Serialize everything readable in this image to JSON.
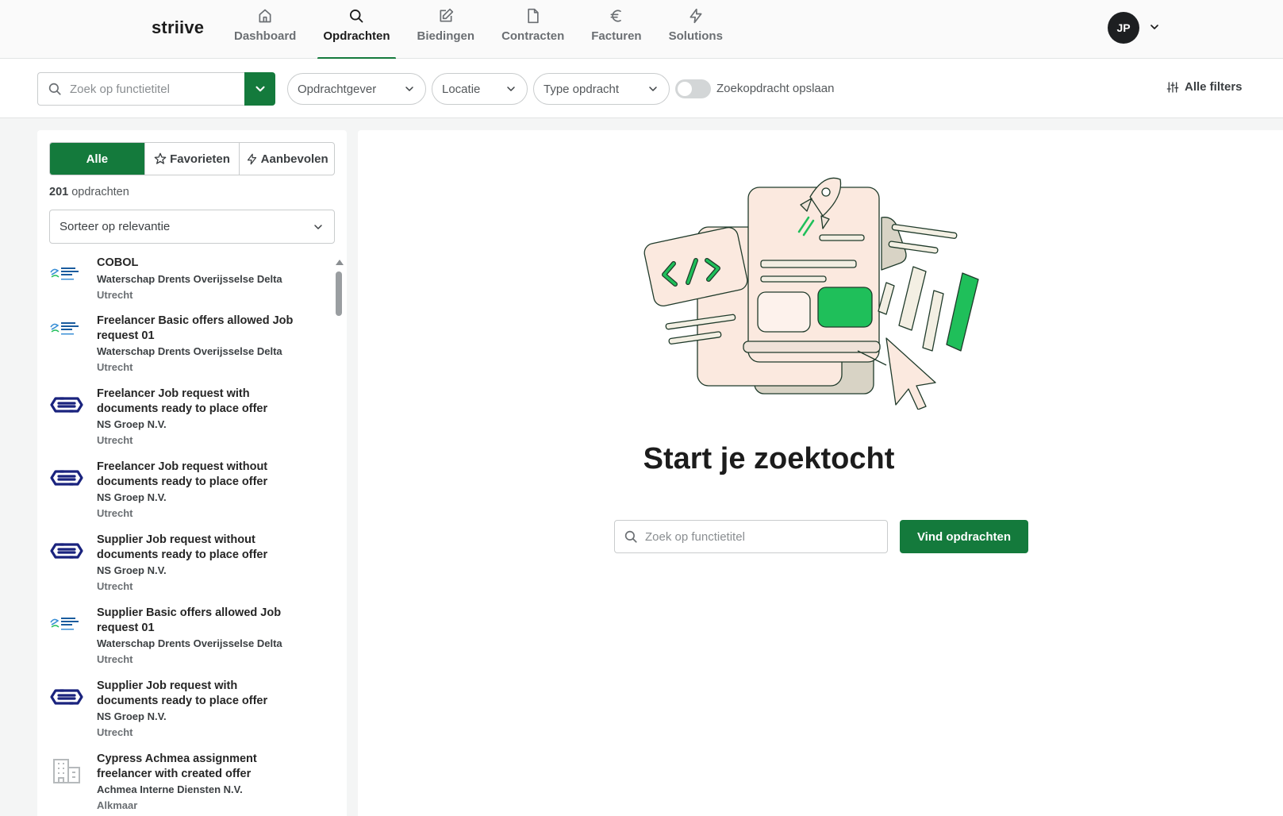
{
  "app": {
    "logo_text": "striive"
  },
  "nav": {
    "items": [
      {
        "label": "Dashboard",
        "icon": "home-icon",
        "active": false
      },
      {
        "label": "Opdrachten",
        "icon": "search-icon",
        "active": true
      },
      {
        "label": "Biedingen",
        "icon": "edit-icon",
        "active": false
      },
      {
        "label": "Contracten",
        "icon": "document-icon",
        "active": false
      },
      {
        "label": "Facturen",
        "icon": "euro-icon",
        "active": false
      },
      {
        "label": "Solutions",
        "icon": "bolt-icon",
        "active": false
      }
    ]
  },
  "user": {
    "initials": "JP"
  },
  "filters": {
    "search_placeholder": "Zoek op functietitel",
    "opdrachtgever": "Opdrachtgever",
    "locatie": "Locatie",
    "type": "Type opdracht",
    "save_search_label": "Zoekopdracht opslaan",
    "save_search_on": false,
    "all_filters": "Alle filters"
  },
  "list": {
    "tabs": {
      "all": "Alle",
      "favorites": "Favorieten",
      "recommended": "Aanbevolen"
    },
    "count_number": "201",
    "count_suffix": " opdrachten",
    "sort": "Sorteer op relevantie",
    "results": [
      {
        "title": "COBOL",
        "client": "Waterschap Drents Overijsselse Delta",
        "location": "Utrecht",
        "logo": "wdod-logo"
      },
      {
        "title": "Freelancer Basic offers allowed Job request 01",
        "client": "Waterschap Drents Overijsselse Delta",
        "location": "Utrecht",
        "logo": "wdod-logo"
      },
      {
        "title": "Freelancer Job request with documents ready to place offer",
        "client": "NS Groep N.V.",
        "location": "Utrecht",
        "logo": "ns-logo"
      },
      {
        "title": "Freelancer Job request without documents ready to place offer",
        "client": "NS Groep N.V.",
        "location": "Utrecht",
        "logo": "ns-logo"
      },
      {
        "title": "Supplier Job request without documents ready to place offer",
        "client": "NS Groep N.V.",
        "location": "Utrecht",
        "logo": "ns-logo"
      },
      {
        "title": "Supplier Basic offers allowed Job request 01",
        "client": "Waterschap Drents Overijsselse Delta",
        "location": "Utrecht",
        "logo": "wdod-logo"
      },
      {
        "title": "Supplier Job request with documents ready to place offer",
        "client": "NS Groep N.V.",
        "location": "Utrecht",
        "logo": "ns-logo"
      },
      {
        "title": "Cypress Achmea assignment freelancer with created offer",
        "client": "Achmea Interne Diensten N.V.",
        "location": "Alkmaar",
        "logo": "building-icon"
      }
    ]
  },
  "main": {
    "headline": "Start je zoektocht",
    "search_placeholder": "Zoek op functietitel",
    "button": "Vind opdrachten"
  },
  "colors": {
    "brand_green": "#147a3c",
    "accent_green": "#1fbf5a",
    "dark": "#1c1c1c",
    "illustration_cream": "#fbe9df",
    "ns_blue": "#1a237e"
  }
}
